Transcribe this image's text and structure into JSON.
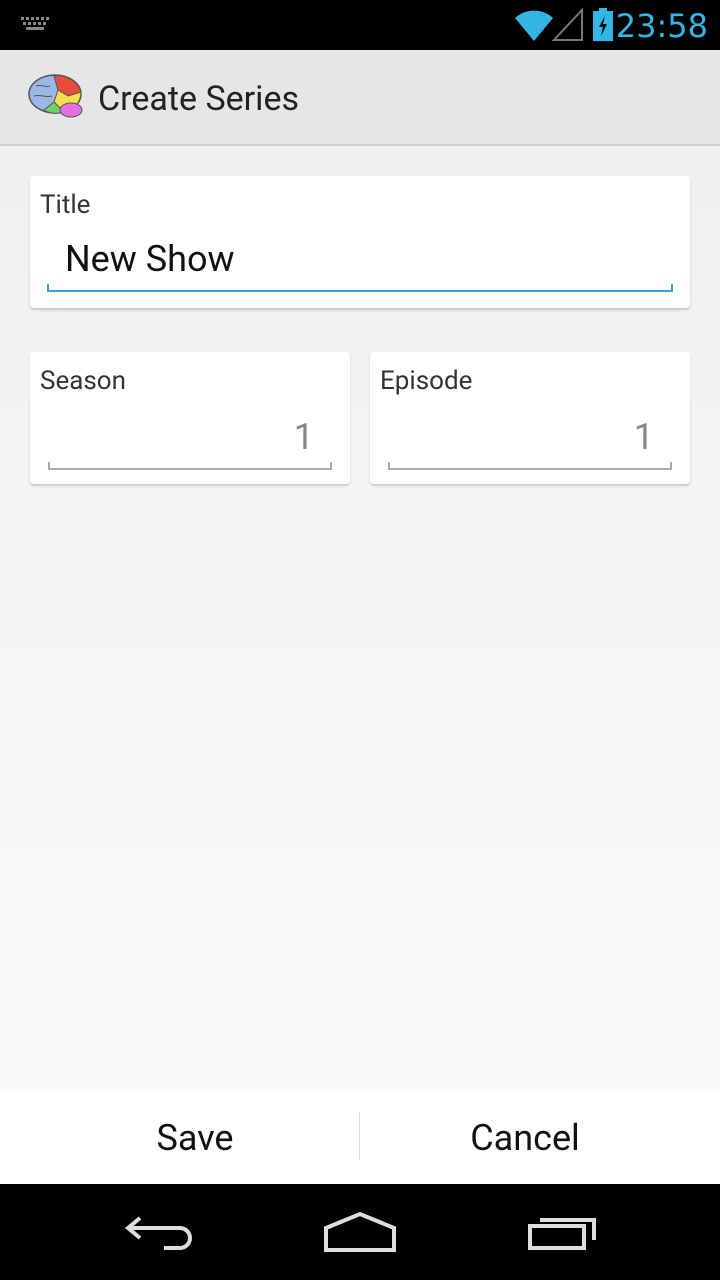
{
  "status_bar": {
    "time": "23:58",
    "icons": [
      "keyboard-icon",
      "wifi-icon",
      "signal-icon",
      "battery-charging-icon"
    ],
    "accent_color": "#33b5e5"
  },
  "action_bar": {
    "app_icon": "brain-icon",
    "title": "Create Series"
  },
  "form": {
    "title": {
      "label": "Title",
      "value": "New Show"
    },
    "season": {
      "label": "Season",
      "value": "1"
    },
    "episode": {
      "label": "Episode",
      "value": "1"
    }
  },
  "buttons": {
    "save_label": "Save",
    "cancel_label": "Cancel"
  },
  "nav_bar": {
    "icons": [
      "back-icon",
      "home-icon",
      "recents-icon"
    ]
  }
}
